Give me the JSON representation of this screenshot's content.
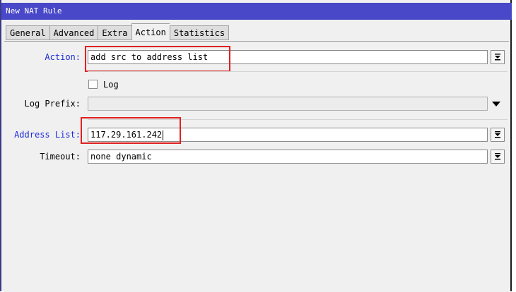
{
  "window": {
    "title": "New NAT Rule"
  },
  "tabs": [
    {
      "label": "General",
      "active": false
    },
    {
      "label": "Advanced",
      "active": false
    },
    {
      "label": "Extra",
      "active": false
    },
    {
      "label": "Action",
      "active": true
    },
    {
      "label": "Statistics",
      "active": false
    }
  ],
  "form": {
    "action": {
      "label": "Action:",
      "value": "add src to address list"
    },
    "log": {
      "label": "Log",
      "checked": false
    },
    "log_prefix": {
      "label": "Log Prefix:",
      "value": ""
    },
    "address_list": {
      "label": "Address List:",
      "value": "117.29.161.242"
    },
    "timeout": {
      "label": "Timeout:",
      "value": "none dynamic"
    }
  },
  "colors": {
    "title_bar": "#4848c8",
    "highlight_label": "#1c2ad8",
    "annotation": "#e02020"
  },
  "icons": {
    "dropdown": "dropdown-double-arrow-icon",
    "expand": "triangle-down-icon"
  }
}
